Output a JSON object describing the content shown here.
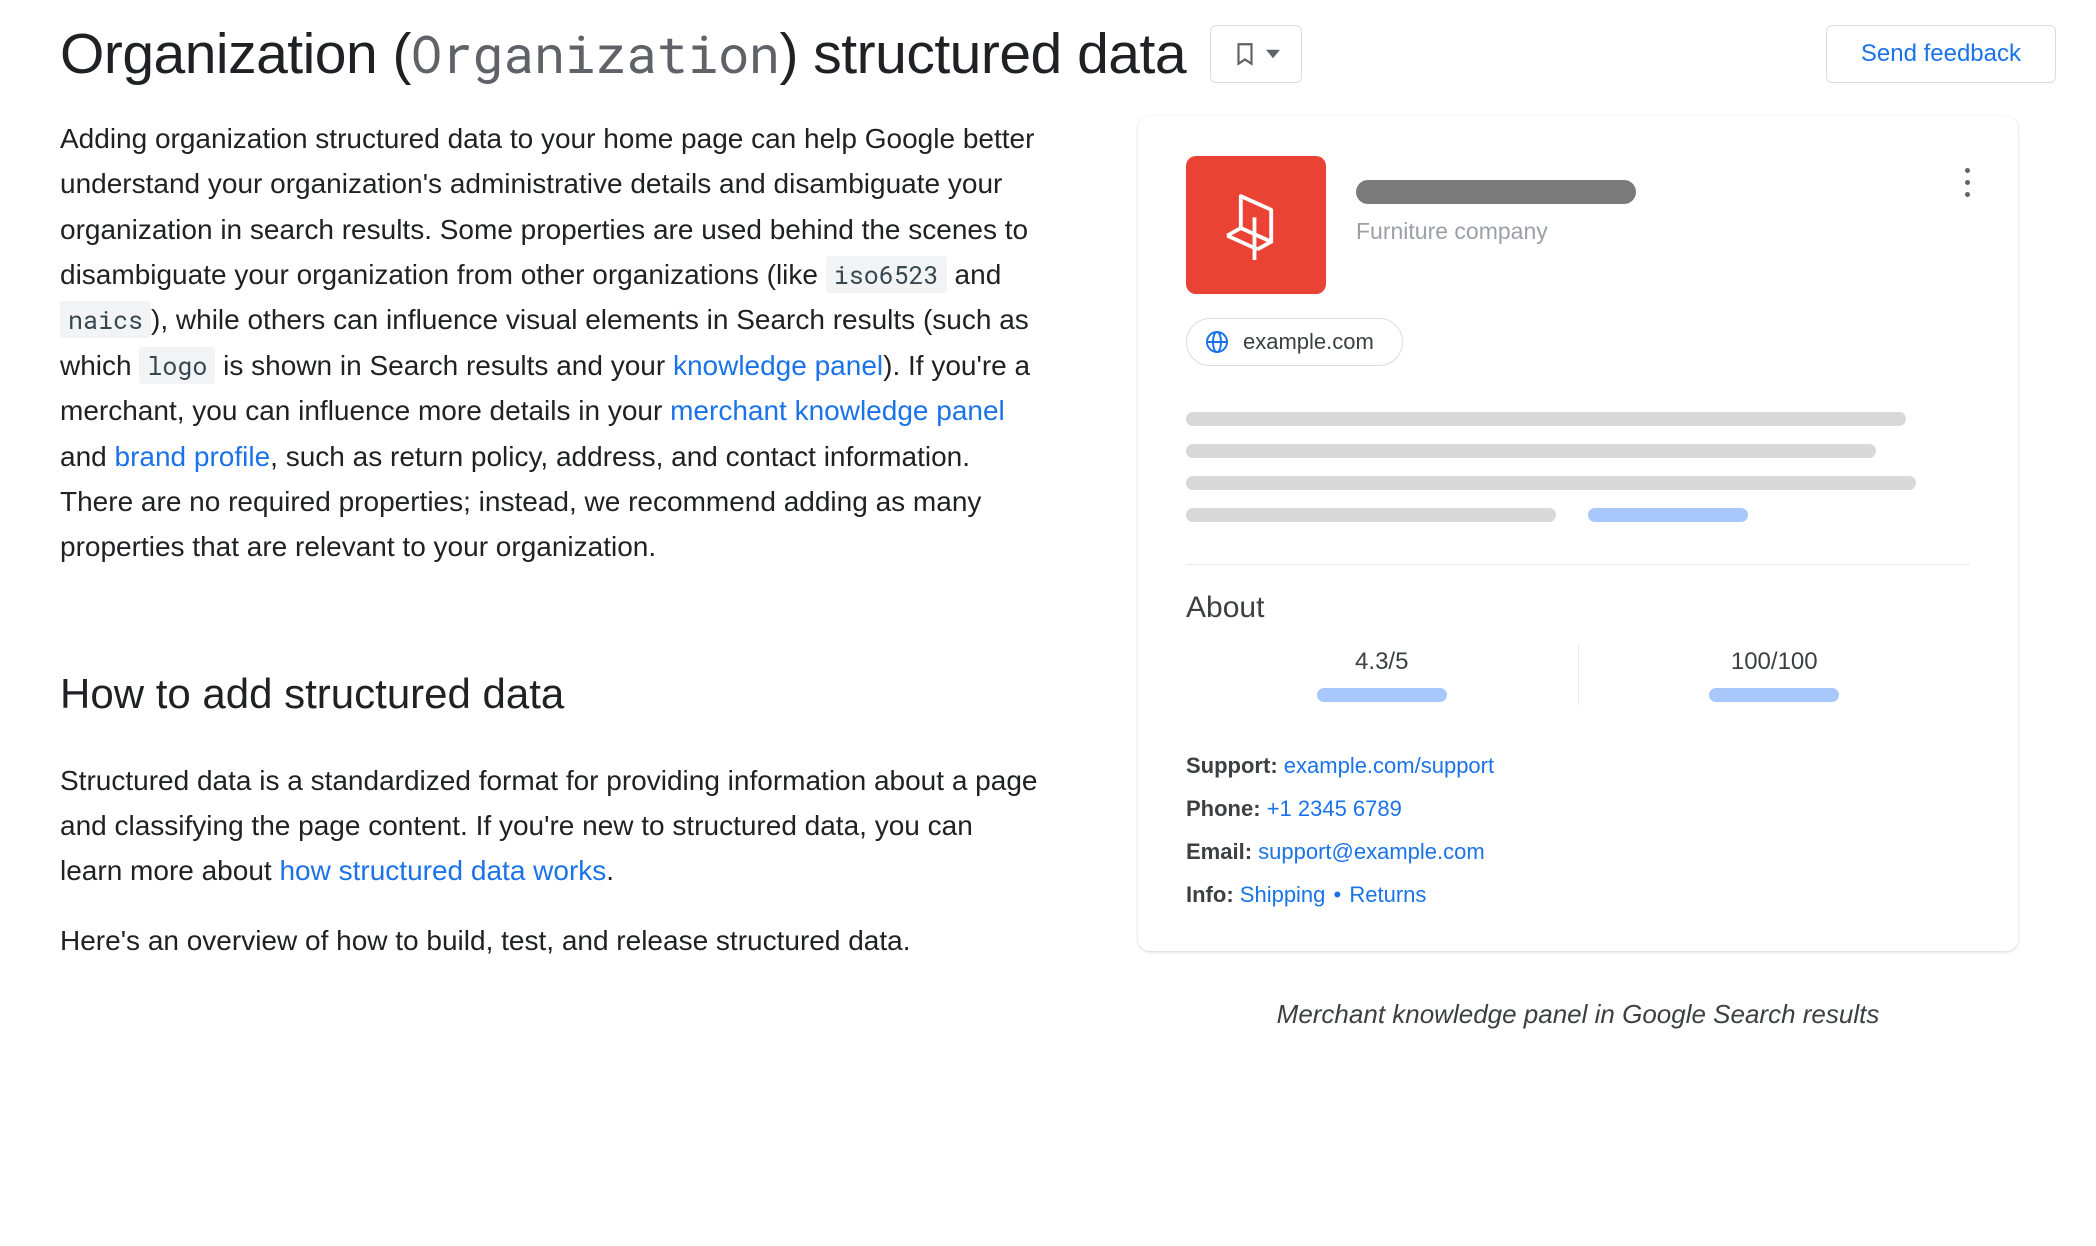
{
  "header": {
    "title_prefix": "Organization (",
    "title_code": "Organization",
    "title_suffix": ") structured data",
    "feedback": "Send feedback"
  },
  "intro": {
    "t1": "Adding organization structured data to your home page can help Google better understand your organization's administrative details and disambiguate your organization in search results. Some properties are used behind the scenes to disambiguate your organization from other organizations (like ",
    "c1": "iso6523",
    "t2": " and ",
    "c2": "naics",
    "t3": "), while others can influence visual elements in Search results (such as which ",
    "c3": "logo",
    "t4": " is shown in Search results and your ",
    "l1": "knowledge panel",
    "t5": "). If you're a merchant, you can influence more details in your ",
    "l2": "merchant knowledge panel",
    "t6": " and ",
    "l3": "brand profile",
    "t7": ", such as return policy, address, and contact information. There are no required properties; instead, we recommend adding as many properties that are relevant to your organization."
  },
  "section2": {
    "heading": "How to add structured data",
    "p1_a": "Structured data is a standardized format for providing information about a page and classifying the page content. If you're new to structured data, you can learn more about ",
    "p1_link": "how structured data works",
    "p1_b": ".",
    "p2": "Here's an overview of how to build, test, and release structured data."
  },
  "panel": {
    "subtitle": "Furniture company",
    "site": "example.com",
    "about": "About",
    "rating1": "4.3/5",
    "rating2": "100/100",
    "support_l": "Support:",
    "support_v": "example.com/support",
    "phone_l": "Phone:",
    "phone_v": "+1 2345 6789",
    "email_l": "Email:",
    "email_v": "support@example.com",
    "info_l": "Info:",
    "info_v1": "Shipping",
    "info_v2": "Returns",
    "caption": "Merchant knowledge panel in Google Search results"
  }
}
